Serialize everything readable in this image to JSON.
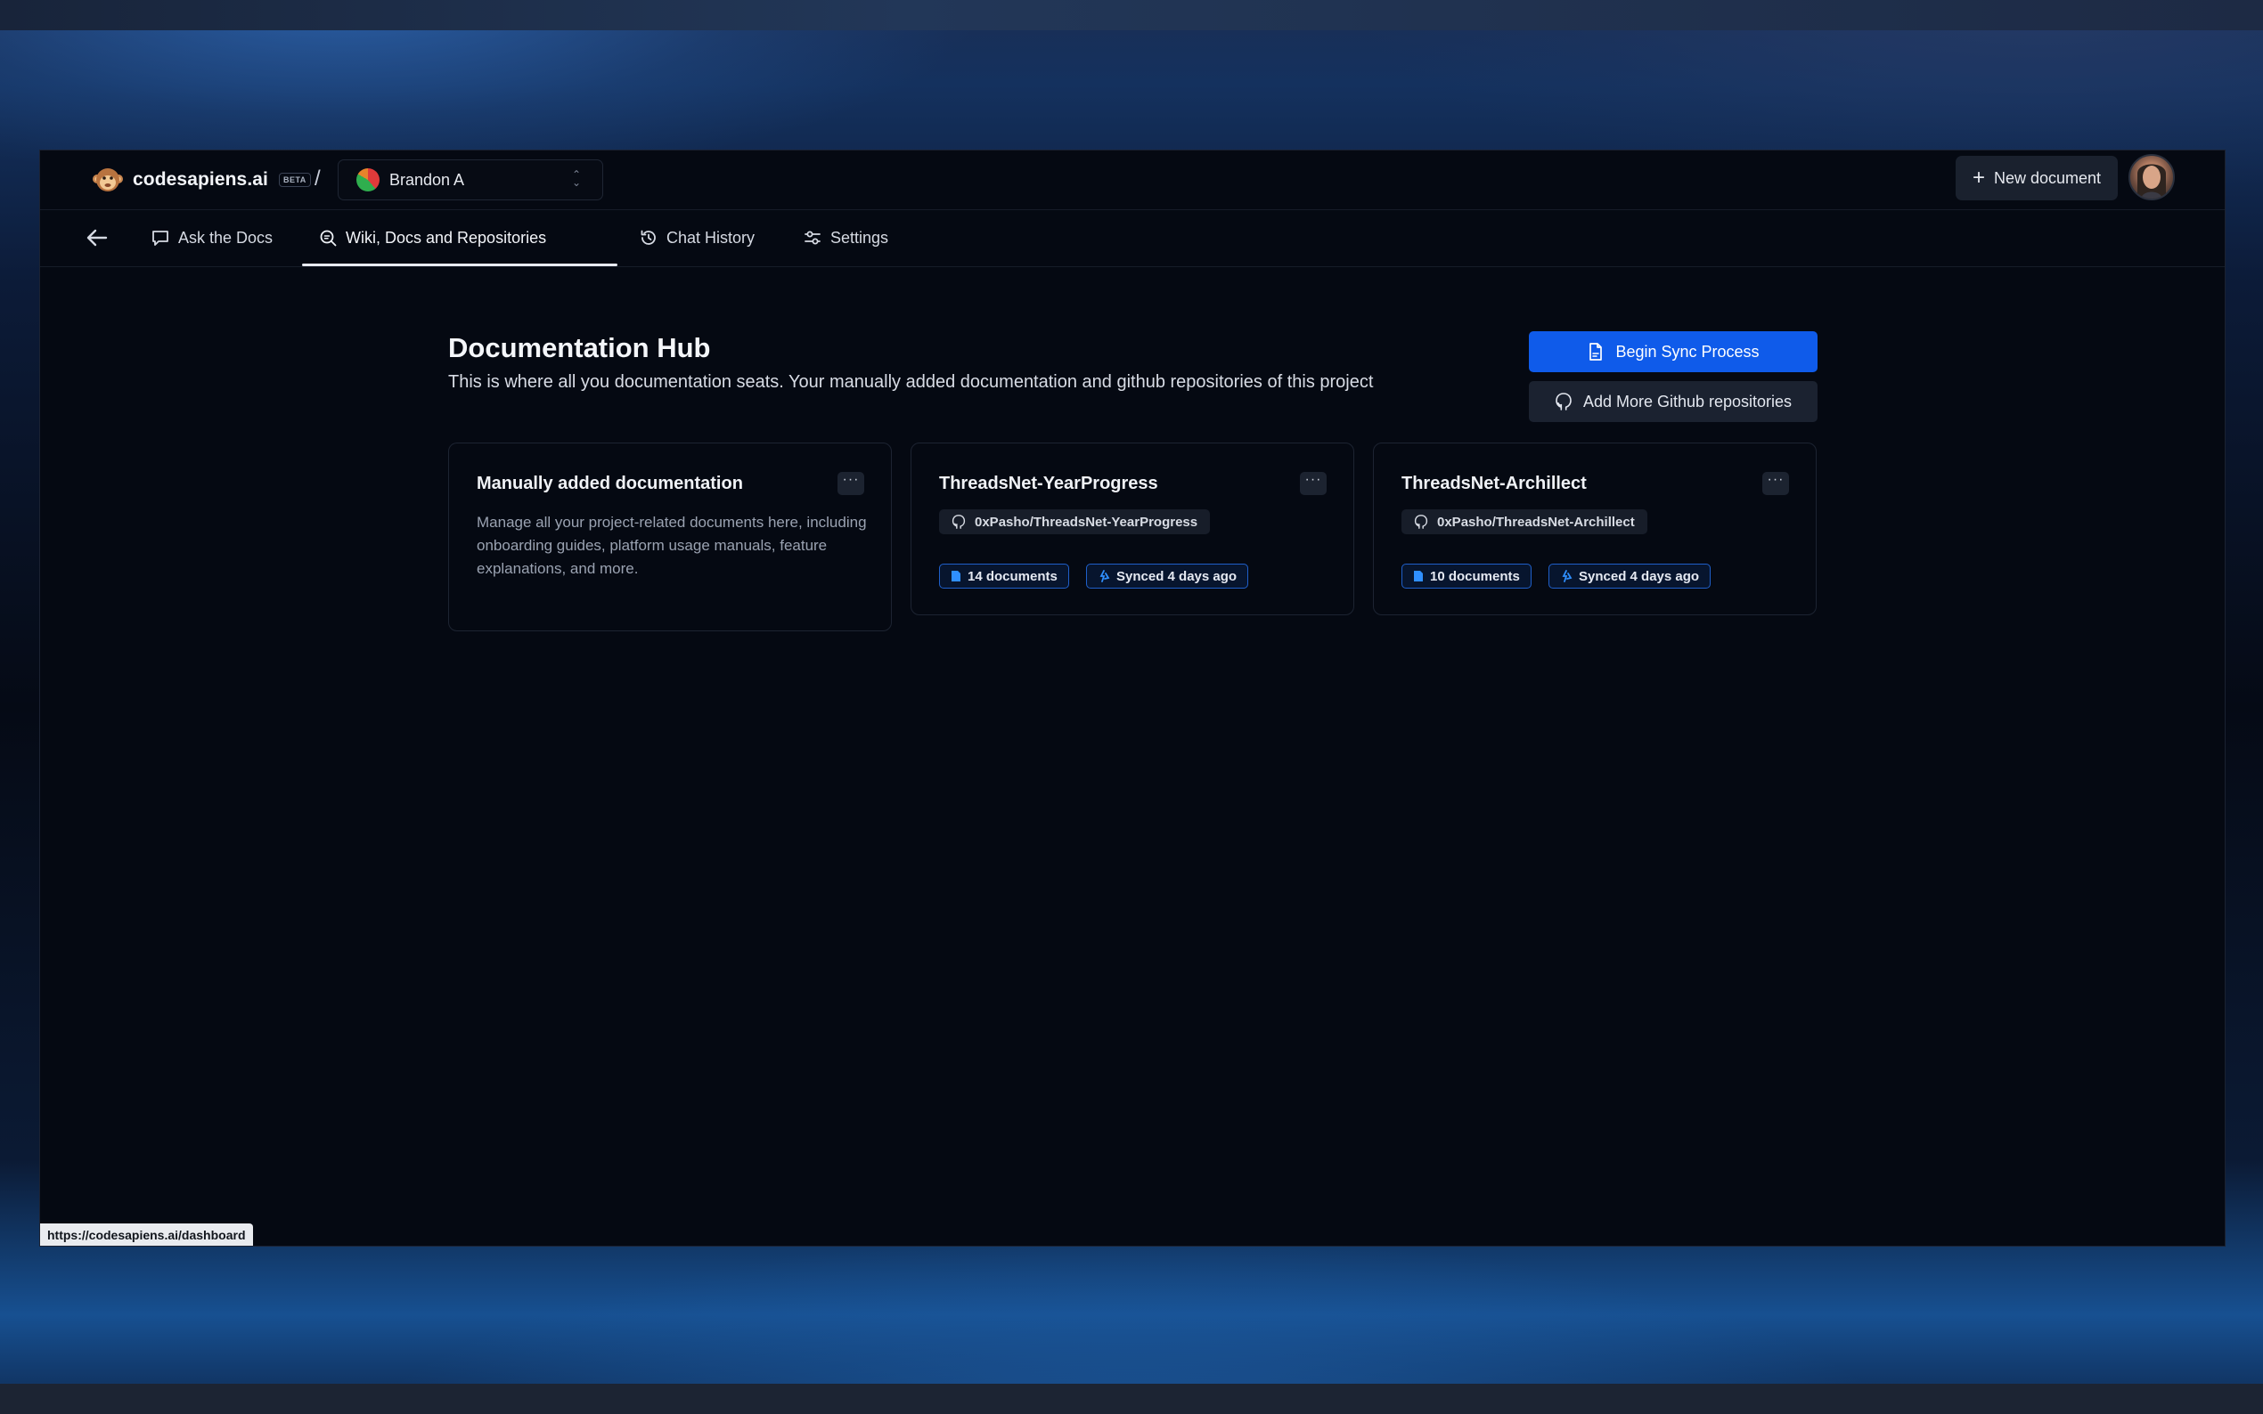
{
  "app": {
    "brand_name": "codesapiens.ai",
    "beta_label": "BETA",
    "breadcrumb_separator": "/",
    "project": "Brandon A"
  },
  "header": {
    "new_document_label": "New document"
  },
  "nav": {
    "tabs": [
      {
        "label": "Ask the Docs",
        "icon": "chat-bubble-icon"
      },
      {
        "label": "Wiki, Docs and Repositories",
        "icon": "search-doc-icon",
        "active": true
      },
      {
        "label": "Chat History",
        "icon": "history-icon"
      },
      {
        "label": "Settings",
        "icon": "sliders-icon"
      }
    ]
  },
  "main": {
    "title": "Documentation Hub",
    "description": "This is where all you documentation seats. Your manually added documentation and github repositories of this project",
    "sync_button_label": "Begin Sync Process",
    "add_repo_button_label": "Add More Github repositories",
    "cards": [
      {
        "title": "Manually added documentation",
        "description": "Manage all your project-related documents here, including onboarding guides, platform usage manuals, feature explanations, and more.",
        "menu": "···"
      },
      {
        "title": "ThreadsNet-YearProgress",
        "repo": "0xPasho/ThreadsNet-YearProgress",
        "documents": "14 documents",
        "synced": "Synced 4 days ago",
        "menu": "···"
      },
      {
        "title": "ThreadsNet-Archillect",
        "repo": "0xPasho/ThreadsNet-Archillect",
        "documents": "10 documents",
        "synced": "Synced 4 days ago",
        "menu": "···"
      }
    ]
  },
  "status_bar": {
    "url": "https://codesapiens.ai/dashboard"
  },
  "colors": {
    "accent": "#0f5bea",
    "background": "#050912",
    "badge_border": "#1f5fc9"
  }
}
